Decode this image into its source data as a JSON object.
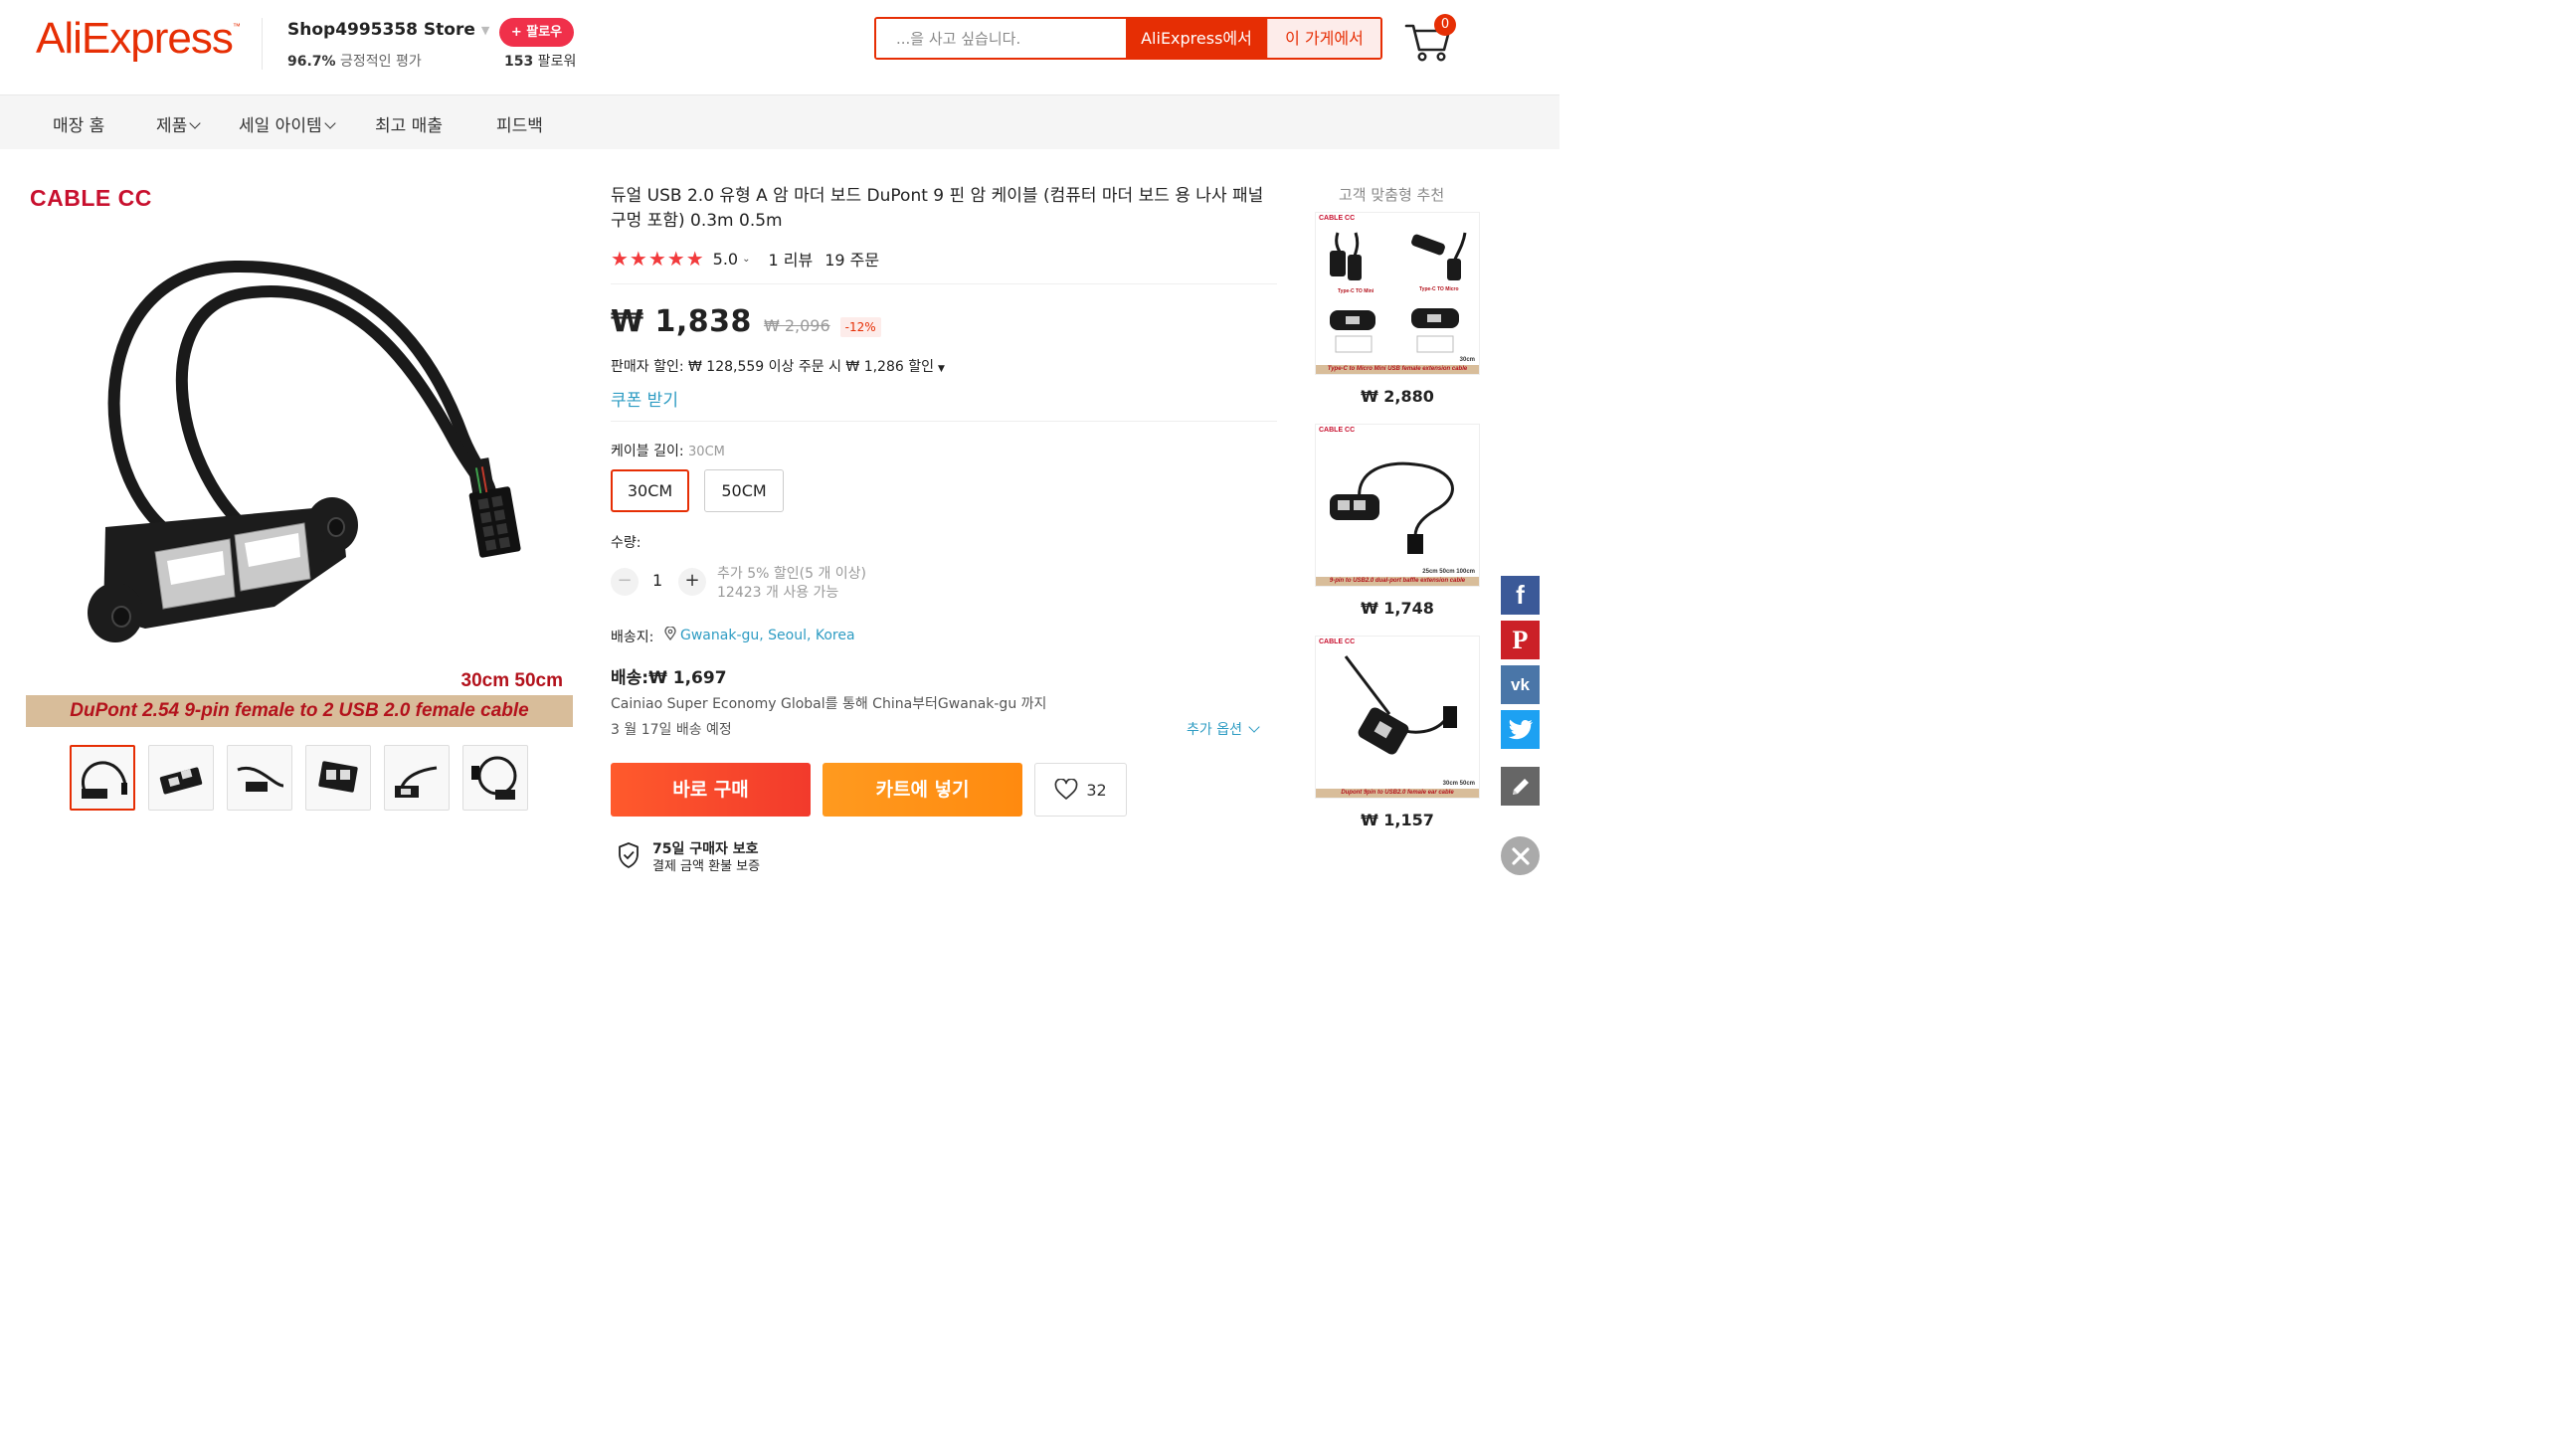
{
  "header": {
    "logo": "AliExpress",
    "store_name": "Shop4995358 Store",
    "store_rating_pct": "96.7%",
    "store_rating_text": " 긍정적인 평가",
    "follow_label": "+ 팔로우",
    "followers_count": "153",
    "followers_text": " 팔로워",
    "search_placeholder": "...을 사고 싶습니다.",
    "search_aliexpress_label": "AliExpress에서",
    "search_store_label": "이 가게에서",
    "cart_count": "0"
  },
  "nav": {
    "items": [
      {
        "label": "매장 홈"
      },
      {
        "label": "제품"
      },
      {
        "label": "세일 아이템"
      },
      {
        "label": "최고 매출"
      },
      {
        "label": "피드백"
      }
    ]
  },
  "gallery": {
    "brand_tag": "CABLE CC",
    "size_caption": "30cm 50cm",
    "banner": "DuPont 2.54 9-pin female to 2 USB 2.0 female cable",
    "thumb_count": 6,
    "active_thumb": 0
  },
  "product": {
    "title": "듀얼 USB 2.0 유형 A 암 마더 보드 DuPont 9 핀 암 케이블 (컴퓨터 마더 보드 용 나사 패널 구멍 포함) 0.3m 0.5m",
    "stars": "★★★★★",
    "rating": "5.0",
    "reviews": "1 리뷰",
    "orders": "19 주문",
    "price": "₩ 1,838",
    "old_price": "₩ 2,096",
    "discount": "-12%",
    "seller_discount": "판매자 할인: ₩ 128,559 이상 주문 시 ₩ 1,286 할인",
    "coupon": "쿠폰 받기",
    "option_label": "케이블 길이: ",
    "option_selected": "30CM",
    "options": [
      "30CM",
      "50CM"
    ],
    "qty_label": "수량:",
    "qty_minus": "−",
    "qty_plus": "+",
    "qty_value": "1",
    "qty_note1": "추가 5% 할인(5 개 이상)",
    "qty_note2": "12423 개 사용 가능",
    "ship_label": "배송지:",
    "ship_location": "Gwanak-gu, Seoul, Korea",
    "ship_cost": "배송:₩ 1,697",
    "ship_via": "Cainiao Super Economy Global를 통해 China부터Gwanak-gu 까지",
    "ship_date": "3 월 17일 배송 예정",
    "more_options": "추가 옵션",
    "buy_now": "바로 구매",
    "add_to_cart": "카트에 넣기",
    "wishlist_count": "32",
    "protection_title": "75일 구매자 보호",
    "protection_sub": "결제 금액 환불 보증"
  },
  "recommendations": {
    "title": "고객 맞춤형 추천",
    "items": [
      {
        "price": "₩ 2,880",
        "brand": "CABLE CC",
        "strip": "Type-C to Micro Mini USB female extension cable",
        "size": "30cm",
        "label_a": "Type-C TO Mini",
        "label_b": "Type-C TO Micro"
      },
      {
        "price": "₩ 1,748",
        "brand": "CABLE CC",
        "strip": "9-pin to USB2.0 dual-port baffle extension cable",
        "size": "25cm 50cm 100cm"
      },
      {
        "price": "₩ 1,157",
        "brand": "CABLE CC",
        "strip": "Dupont 9pin to USB2.0 female ear cable",
        "size": "30cm 50cm"
      }
    ]
  },
  "share": {
    "facebook": "f",
    "pinterest": "P",
    "vk": "vk"
  },
  "colors": {
    "brand": "#e62e04",
    "buy": "#f23a2c",
    "cart": "#ff8a0f",
    "link": "#2e9cc3",
    "star": "#f23a3c"
  }
}
